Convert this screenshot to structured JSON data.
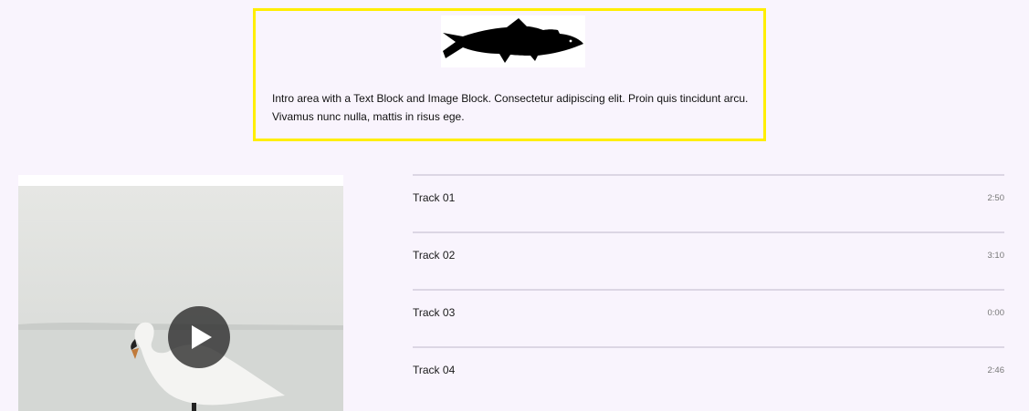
{
  "intro": {
    "logo_icon": "fish-silhouette-icon",
    "text": "Intro area with a Text Block and Image Block. Consectetur adipiscing elit. Proin quis tincidunt arcu. Vivamus nunc nulla, mattis in risus ege.",
    "border_color": "#ffee00"
  },
  "media": {
    "image_subject": "swan-photo",
    "play_icon": "play-icon"
  },
  "tracks": [
    {
      "title": "Track 01",
      "duration": "2:50"
    },
    {
      "title": "Track 02",
      "duration": "3:10"
    },
    {
      "title": "Track 03",
      "duration": "0:00"
    },
    {
      "title": "Track 04",
      "duration": "2:46"
    }
  ],
  "colors": {
    "background": "#f9f4fd",
    "divider": "#dcd6e4"
  }
}
